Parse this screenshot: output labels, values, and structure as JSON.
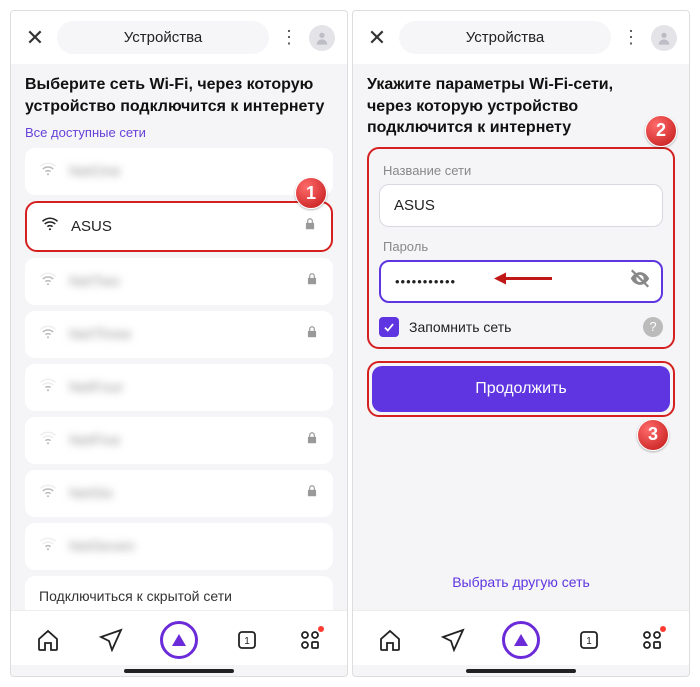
{
  "header": {
    "title": "Устройства"
  },
  "left": {
    "heading": "Выберите сеть Wi-Fi, через которую устройство подключится к интернету",
    "subhead": "Все доступные сети",
    "networks": [
      {
        "ssid": "NetOne",
        "locked": false,
        "strength": 2,
        "blurred": true
      },
      {
        "ssid": "ASUS",
        "locked": true,
        "strength": 3,
        "blurred": false,
        "highlighted": true
      },
      {
        "ssid": "NetTwo",
        "locked": true,
        "strength": 2,
        "blurred": true
      },
      {
        "ssid": "NetThree",
        "locked": true,
        "strength": 2,
        "blurred": true
      },
      {
        "ssid": "NetFour",
        "locked": false,
        "strength": 1,
        "blurred": true
      },
      {
        "ssid": "NetFive",
        "locked": true,
        "strength": 1,
        "blurred": true
      },
      {
        "ssid": "NetSix",
        "locked": true,
        "strength": 2,
        "blurred": true
      },
      {
        "ssid": "NetSeven",
        "locked": false,
        "strength": 1,
        "blurred": true
      }
    ],
    "hidden_link": "Подключиться к скрытой сети",
    "badge": "1"
  },
  "right": {
    "heading": "Укажите параметры Wi-Fi-сети, через которую устройство подключится к интернету",
    "name_label": "Название сети",
    "name_value": "ASUS",
    "pw_label": "Пароль",
    "pw_value": "•••••••••••",
    "remember": "Запомнить сеть",
    "continue": "Продолжить",
    "alt": "Выбрать другую сеть",
    "badge_form": "2",
    "badge_btn": "3"
  }
}
